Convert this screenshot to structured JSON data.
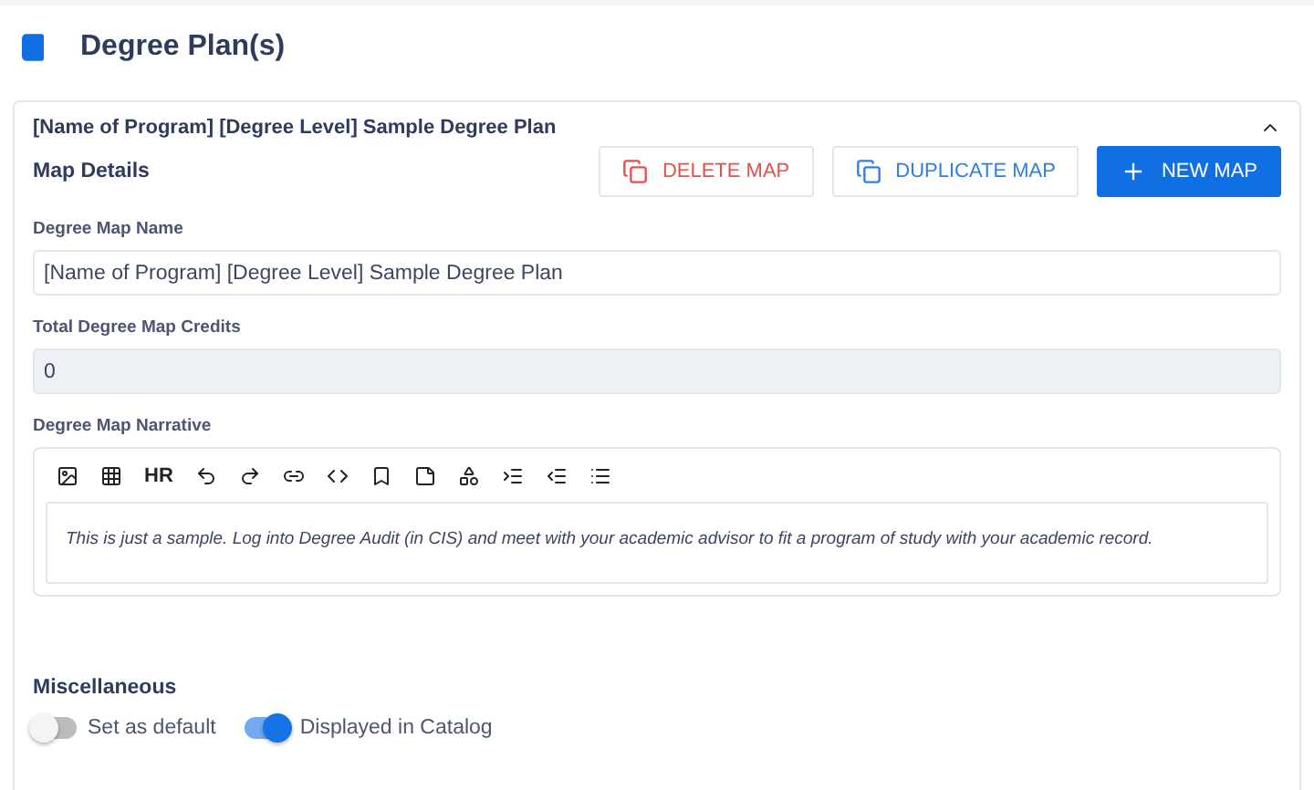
{
  "page": {
    "title": "Degree Plan(s)"
  },
  "panel": {
    "title": "[Name of Program] [Degree Level] Sample Degree Plan",
    "expanded": true,
    "section": "Map Details",
    "buttons": [
      {
        "kind": "danger",
        "label": "DELETE MAP"
      },
      {
        "kind": "outline",
        "label": "DUPLICATE MAP"
      },
      {
        "kind": "primary",
        "label": "NEW MAP"
      }
    ],
    "fields": [
      {
        "label": "Degree Map Name",
        "value": "[Name of Program] [Degree Level] Sample Degree Plan",
        "disabled": false
      },
      {
        "label": "Total Degree Map Credits",
        "value": "0",
        "disabled": true
      }
    ],
    "narrative": {
      "label": "Degree Map Narrative",
      "toolbar_text": "HR",
      "text": "This is just a sample. Log into Degree Audit (in CIS) and meet with your academic advisor to fit a program of study with your academic record."
    }
  },
  "misc": {
    "title": "Miscellaneous",
    "toggles": [
      {
        "label": "Set as default",
        "on": false
      },
      {
        "label": "Displayed in Catalog",
        "on": true
      }
    ]
  }
}
